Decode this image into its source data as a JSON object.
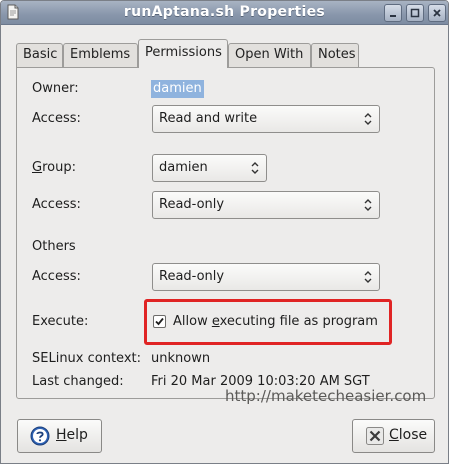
{
  "window": {
    "title": "runAptana.sh Properties"
  },
  "tabs": [
    {
      "label": "Basic"
    },
    {
      "label": "Emblems"
    },
    {
      "label": "Permissions",
      "active": true
    },
    {
      "label": "Open With"
    },
    {
      "label": "Notes"
    }
  ],
  "permissions": {
    "owner_label": "Owner:",
    "owner_value": "damien",
    "owner_access_label": "Access:",
    "owner_access_value": "Read and write",
    "group_label_pre": "",
    "group_label_ul": "G",
    "group_label_post": "roup:",
    "group_value": "damien",
    "group_access_label": "Access:",
    "group_access_value": "Read-only",
    "others_label": "Others",
    "others_access_label": "Access:",
    "others_access_value": "Read-only",
    "execute_label": "Execute:",
    "execute_checkbox": {
      "checked": true,
      "label_pre": "Allow ",
      "label_ul": "e",
      "label_post": "xecuting file as program"
    },
    "selinux_label": "SELinux context:",
    "selinux_value": "unknown",
    "last_changed_label": "Last changed:",
    "last_changed_value": "Fri 20 Mar 2009 10:03:20 AM SGT"
  },
  "watermark": "http://maketecheasier.com",
  "buttons": {
    "help_ul": "H",
    "help_rest": "elp",
    "close_ul": "C",
    "close_rest": "lose"
  },
  "icons": {
    "window": "document-icon",
    "help": "help-icon",
    "close": "close-icon"
  },
  "colors": {
    "titlebar": "#8896ab",
    "selection": "#8fb3de",
    "highlight_box": "#e02424"
  }
}
